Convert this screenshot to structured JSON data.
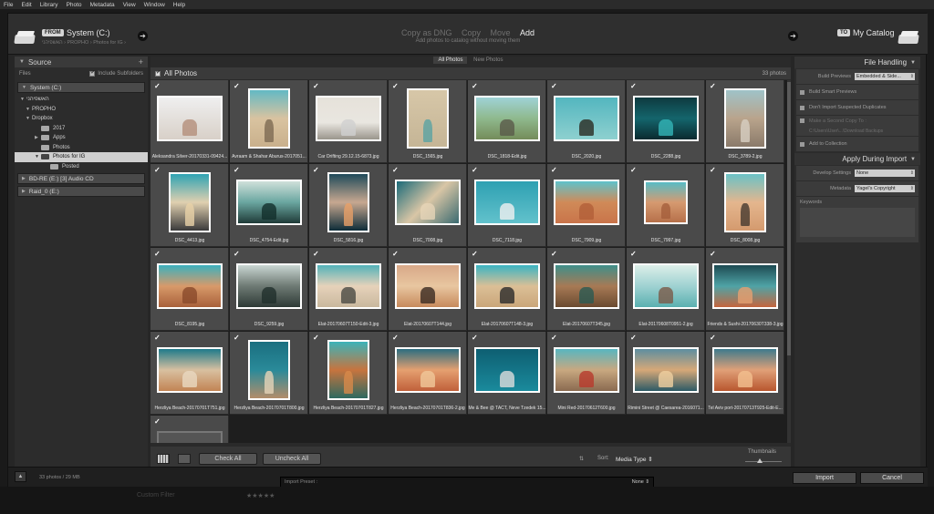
{
  "menubar": [
    "File",
    "Edit",
    "Library",
    "Photo",
    "Metadata",
    "View",
    "Window",
    "Help"
  ],
  "header": {
    "from_badge": "FROM",
    "source": "System (C:)",
    "source_path": "האשפיהני › PROPHO › Photos for IG ›",
    "modes": [
      "Copy as DNG",
      "Copy",
      "Move",
      "Add"
    ],
    "active_mode": "Add",
    "mode_desc": "Add photos to catalog without moving them",
    "to_badge": "TO",
    "destination": "My Catalog"
  },
  "source_panel": {
    "title": "Source",
    "files_label": "Files",
    "include_subfolders": "Include Subfolders",
    "volumes": [
      {
        "label": "System (C:)"
      },
      {
        "label": "BD-RE (E:) [3] Audio CD"
      },
      {
        "label": "Raid_0 (E:)"
      }
    ],
    "tree": [
      {
        "label": "האשפיהני"
      },
      {
        "label": "PROPHO"
      },
      {
        "label": "Dropbox"
      },
      {
        "label": "2017"
      },
      {
        "label": "Apps"
      },
      {
        "label": "Photos"
      },
      {
        "label": "Photos for IG"
      },
      {
        "label": "Posted"
      }
    ]
  },
  "grid": {
    "tabs": [
      "All Photos",
      "New Photos"
    ],
    "title": "All Photos",
    "count": "33 photos",
    "photos": [
      {
        "name": "Aleksandra Silver-20170331-09424...",
        "ratio": "land",
        "bg": "linear-gradient(#efefef,#d8d0c8)",
        "fg": "#b48f7a"
      },
      {
        "name": "Avraam & Shahar Aburus-2017051...",
        "ratio": "port",
        "bg": "linear-gradient(#63b9c4,#d9c3a0,#c9b08c)",
        "fg": "#7d6a52"
      },
      {
        "name": "Car Drifting 29.12.15-6873.jpg",
        "ratio": "land",
        "bg": "linear-gradient(#e6e2da,#e9e6e0 60%,#9a958c)",
        "fg": "#cfcfcf"
      },
      {
        "name": "DSC_1565.jpg",
        "ratio": "port",
        "bg": "linear-gradient(#d7c7a8,#c5b596)",
        "fg": "#5aa3a3"
      },
      {
        "name": "DSC_1818-Edit.jpg",
        "ratio": "land",
        "bg": "linear-gradient(#9fd2d6,#8fb98d,#748c5a)",
        "fg": "#5a5a4a"
      },
      {
        "name": "DSC_2020.jpg",
        "ratio": "land",
        "bg": "linear-gradient(#53b6bf,#8ed0cf)",
        "fg": "#2a2a22"
      },
      {
        "name": "DSC_2288.jpg",
        "ratio": "land",
        "bg": "linear-gradient(#0e3a3f,#14656c,#0a2a2f)",
        "fg": "#33b5b8"
      },
      {
        "name": "DSC_3789-2.jpg",
        "ratio": "port",
        "bg": "linear-gradient(#9fc3c8,#b9a48c,#8a7a6a)",
        "fg": "#d8cfc3"
      },
      {
        "name": "DSC_4413.jpg",
        "ratio": "port",
        "bg": "linear-gradient(#2fa3b3,#e0d0b0,#3a3a3a)",
        "fg": "#e8d2a8"
      },
      {
        "name": "DSC_4754-Edit.jpg",
        "ratio": "land",
        "bg": "linear-gradient(#cfe0da,#6aa6a0,#1f3b38)",
        "fg": "#13302c"
      },
      {
        "name": "DSC_5816.jpg",
        "ratio": "port",
        "bg": "linear-gradient(#1f4a5a,#c7a890,#0d2c38)",
        "fg": "#e8a068"
      },
      {
        "name": "DSC_7008.jpg",
        "ratio": "land",
        "bg": "linear-gradient(135deg,#1a6a78,#d9c6a6,#3a6a70)",
        "fg": "#e6d5b8"
      },
      {
        "name": "DSC_7118.jpg",
        "ratio": "land",
        "bg": "linear-gradient(#2ea0b2,#62c2cc)",
        "fg": "#f0f0f0"
      },
      {
        "name": "DSC_7909.jpg",
        "ratio": "land",
        "bg": "linear-gradient(#5fc2cc,#d08a58,#c9744a)",
        "fg": "#b25f38"
      },
      {
        "name": "DSC_7997.jpg",
        "ratio": "sq",
        "bg": "linear-gradient(#57bcc6,#d69a70,#b6704a)",
        "fg": "#a55f3c"
      },
      {
        "name": "DSC_8008.jpg",
        "ratio": "port",
        "bg": "linear-gradient(#6ac2c6,#e4b68e,#d49a6e)",
        "fg": "#463a30"
      },
      {
        "name": "DSC_8195.jpg",
        "ratio": "land",
        "bg": "linear-gradient(#3cb0bd,#d89a6a,#a8603a)",
        "fg": "#8a4a2a"
      },
      {
        "name": "DSC_9259.jpg",
        "ratio": "land",
        "bg": "linear-gradient(#c9d6d2,#6e7a74,#2e3a36)",
        "fg": "#20302c"
      },
      {
        "name": "Elat-20170607T150-Edit-3.jpg",
        "ratio": "land",
        "bg": "linear-gradient(#53b2b9,#e6d2ba,#c9b89e)",
        "fg": "#4a4a44"
      },
      {
        "name": "Elat-20170607T144.jpg",
        "ratio": "land",
        "bg": "linear-gradient(#d8a888,#e8c6a0,#c78a5c)",
        "fg": "#3a2a22"
      },
      {
        "name": "Elat-20170607T148-3.jpg",
        "ratio": "land",
        "bg": "linear-gradient(#3bb4c2,#dbbf96,#caa67a)",
        "fg": "#2b2b2b"
      },
      {
        "name": "Elat-20170607T345.jpg",
        "ratio": "land",
        "bg": "linear-gradient(#3f8f8a,#a77a55,#6a4a30)",
        "fg": "#2a5a52"
      },
      {
        "name": "Elat-20170608T0951-2.jpg",
        "ratio": "land",
        "bg": "linear-gradient(#dceee8,#9fd2d2,#5ab0b0)",
        "fg": "#7a5a48"
      },
      {
        "name": "Friends & Sushi-20170630T338-3.jpg",
        "ratio": "land",
        "bg": "linear-gradient(#1d4a52,#4fa3a6,#c5653e)",
        "fg": "#e6a070"
      },
      {
        "name": "Herzliya Beach-20170701T751.jpg",
        "ratio": "land",
        "bg": "linear-gradient(#1f7a8a,#d8c0a0,#c28454)",
        "fg": "#e8d8c0"
      },
      {
        "name": "Herzliya Beach-20170701T800.jpg",
        "ratio": "port",
        "bg": "linear-gradient(#1a6f80,#2a8a99,#b38d6a)",
        "fg": "#e6d3b8"
      },
      {
        "name": "Herzliya Beach-20170701T827.jpg",
        "ratio": "port",
        "bg": "linear-gradient(#3cb3b9,#c7743e,#2e6a60)",
        "fg": "#d88a4a"
      },
      {
        "name": "Herzliya Beach-20170701T836-2.jpg",
        "ratio": "land",
        "bg": "linear-gradient(#2c6d80,#e5a070,#c0603a)",
        "fg": "#f0c89a"
      },
      {
        "name": "Me & Bee @ TACT, Neve Tzedek 15...",
        "ratio": "land",
        "bg": "linear-gradient(#0e5f72,#1a8a9c)",
        "fg": "#dcdcdc"
      },
      {
        "name": "Mini Red-20170612T600.jpg",
        "ratio": "land",
        "bg": "linear-gradient(#58b6c0,#c8a880,#8a6a50)",
        "fg": "#b83a2c"
      },
      {
        "name": "Rimini Street @ Caesarea-2016071...",
        "ratio": "land",
        "bg": "linear-gradient(#5d8ea0,#d6a878,#2d5a66)",
        "fg": "#f0d0a0"
      },
      {
        "name": "Tel Aviv port-20170713T925-Edit-E...",
        "ratio": "land",
        "bg": "linear-gradient(#3e7a8c,#e0a078,#b8562e)",
        "fg": "#f2c090"
      },
      {
        "name": "",
        "ratio": "land",
        "bg": "linear-gradient(#555,#555)",
        "fg": "#555"
      }
    ]
  },
  "toolbar": {
    "check_all": "Check All",
    "uncheck_all": "Uncheck All",
    "sort_label": "Sort:",
    "sort_value": "Media Type ⇕",
    "thumbnails_label": "Thumbnails",
    "thumbnail_size": 0.4
  },
  "file_handling": {
    "title": "File Handling",
    "build_previews_label": "Build Previews",
    "build_previews_value": "Embedded & Side...",
    "options": [
      "Build Smart Previews",
      "Don't Import Suspected Duplicates",
      "Make a Second Copy To :",
      "Add to Collection"
    ],
    "second_copy_path": "C:\\Users\\User\\...\\Download Backups"
  },
  "apply_during_import": {
    "title": "Apply During Import",
    "develop_label": "Develop Settings",
    "develop_value": "None",
    "metadata_label": "Metadata",
    "metadata_value": "Yagel's Copyright",
    "keywords_label": "Keywords"
  },
  "bottom": {
    "size_info": "33 photos / 29 MB",
    "preset_label": "Import Preset :",
    "preset_value": "None ⇕",
    "import": "Import",
    "cancel": "Cancel"
  },
  "background_strip": {
    "left": "Custom Filter",
    "stars": "★★★★★"
  }
}
